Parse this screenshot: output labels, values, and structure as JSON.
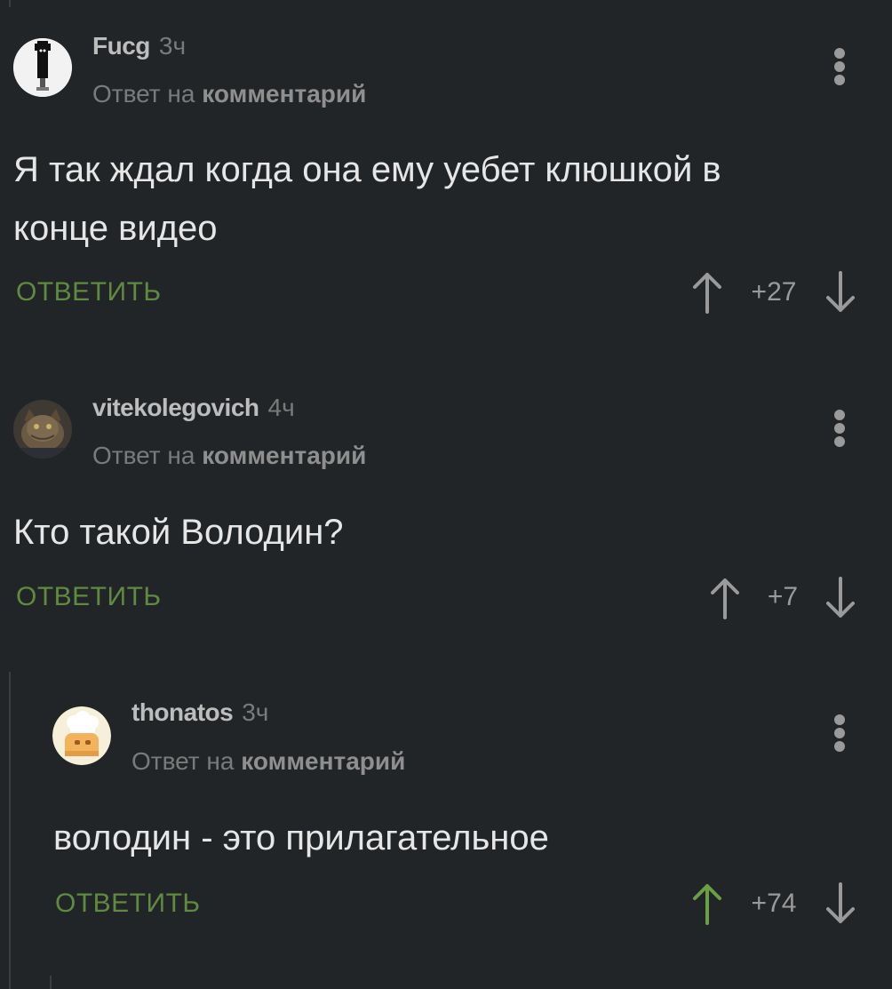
{
  "colors": {
    "background": "#222528",
    "reply_green": "#5f8a3f",
    "upvoted_green": "#6a9f45",
    "muted": "#9a9a9a"
  },
  "comments": [
    {
      "author": "Fucg",
      "time": "3ч",
      "reply_prefix": "Ответ на",
      "reply_target": "комментарий",
      "text_line1": "Я так ждал когда она ему уебет клюшкой в",
      "text_line2": "конце видео",
      "reply_label": "ОТВЕТИТЬ",
      "score": "+27",
      "upvoted": false,
      "avatar_icon": "black-figure-avatar-icon"
    },
    {
      "author": "vitekolegovich",
      "time": "4ч",
      "reply_prefix": "Ответ на",
      "reply_target": "комментарий",
      "text_line1": "Кто такой Володин?",
      "reply_label": "ОТВЕТИТЬ",
      "score": "+7",
      "upvoted": false,
      "avatar_icon": "cat-photo-avatar-icon"
    },
    {
      "author": "thonatos",
      "time": "3ч",
      "reply_prefix": "Ответ на",
      "reply_target": "комментарий",
      "text_line1": "володин - это прилагательное",
      "reply_label": "ОТВЕТИТЬ",
      "score": "+74",
      "upvoted": true,
      "avatar_icon": "chef-emoji-avatar-icon"
    }
  ]
}
